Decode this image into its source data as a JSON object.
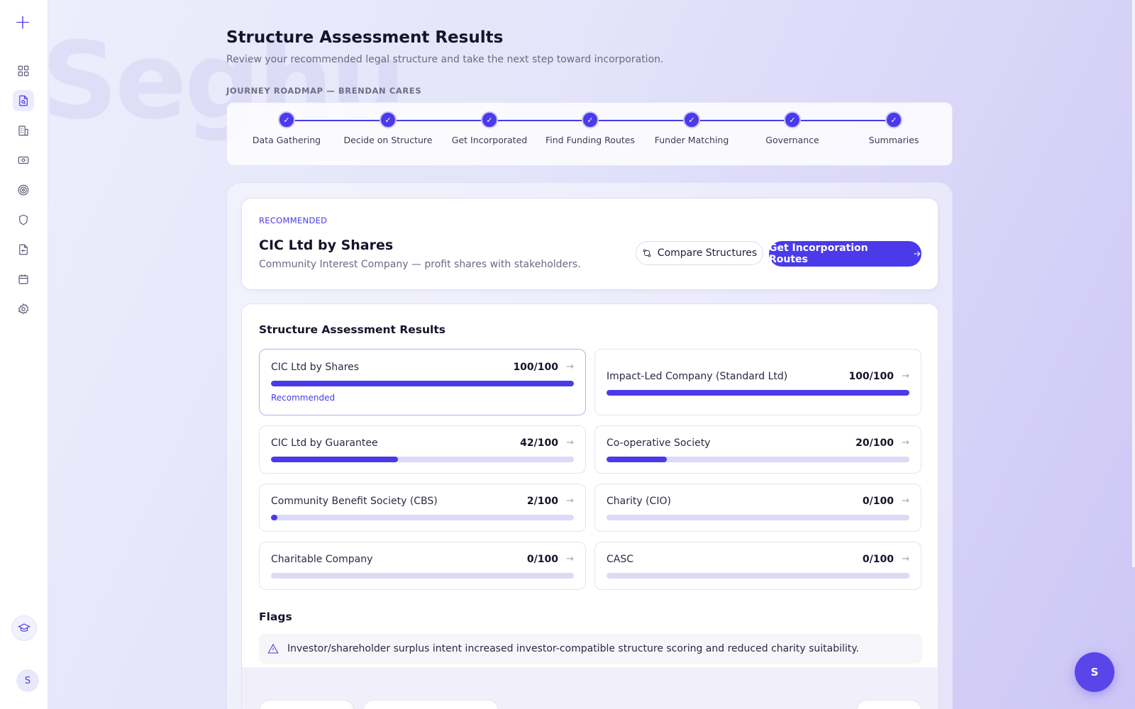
{
  "sidebar": {
    "logo": "+",
    "icons": [
      "dashboard-icon",
      "document-search-icon",
      "building-icon",
      "money-icon",
      "target-icon",
      "shield-icon",
      "file-export-icon",
      "calendar-icon",
      "settings-icon"
    ],
    "learn_icon": "graduation-cap-icon",
    "avatar": "S"
  },
  "watermark": "Seghu",
  "header": {
    "title": "Structure Assessment Results",
    "subtitle": "Review your recommended legal structure and take the next step toward incorporation."
  },
  "roadmap": {
    "label": "JOURNEY ROADMAP — BRENDAN CARES",
    "steps": [
      {
        "label": "Data Gathering",
        "check": "✓"
      },
      {
        "label": "Decide on Structure",
        "check": "✓"
      },
      {
        "label": "Get Incorporated",
        "check": "✓"
      },
      {
        "label": "Find Funding Routes",
        "check": "✓"
      },
      {
        "label": "Funder Matching",
        "check": "✓"
      },
      {
        "label": "Governance",
        "check": "✓"
      },
      {
        "label": "Summaries",
        "check": "✓"
      }
    ]
  },
  "recommendation": {
    "eyebrow": "RECOMMENDED",
    "title": "CIC Ltd by Shares",
    "description": "Community Interest Company — profit shares with stakeholders.",
    "compare_label": "Compare Structures",
    "routes_label": "Get Incorporation Routes"
  },
  "results": {
    "title": "Structure Assessment Results",
    "items": [
      {
        "name": "CIC Ltd by Shares",
        "score": "100/100",
        "value": 100,
        "tag": "Recommended"
      },
      {
        "name": "Impact-Led Company (Standard Ltd)",
        "score": "100/100",
        "value": 100,
        "tag": ""
      },
      {
        "name": "CIC Ltd by Guarantee",
        "score": "42/100",
        "value": 42,
        "tag": ""
      },
      {
        "name": "Co-operative Society",
        "score": "20/100",
        "value": 20,
        "tag": ""
      },
      {
        "name": "Community Benefit Society (CBS)",
        "score": "2/100",
        "value": 2,
        "tag": ""
      },
      {
        "name": "Charity (CIO)",
        "score": "0/100",
        "value": 0,
        "tag": ""
      },
      {
        "name": "Charitable Company",
        "score": "0/100",
        "value": 0,
        "tag": ""
      },
      {
        "name": "CASC",
        "score": "0/100",
        "value": 0,
        "tag": ""
      }
    ],
    "arrow": "→"
  },
  "flags": {
    "title": "Flags",
    "items": [
      "Investor/shareholder surplus intent increased investor-compatible structure scoring and reduced charity suitability."
    ]
  },
  "fab": {
    "label": "S"
  },
  "colors": {
    "accent": "#4a3aea",
    "track": "#dcdaf7"
  }
}
